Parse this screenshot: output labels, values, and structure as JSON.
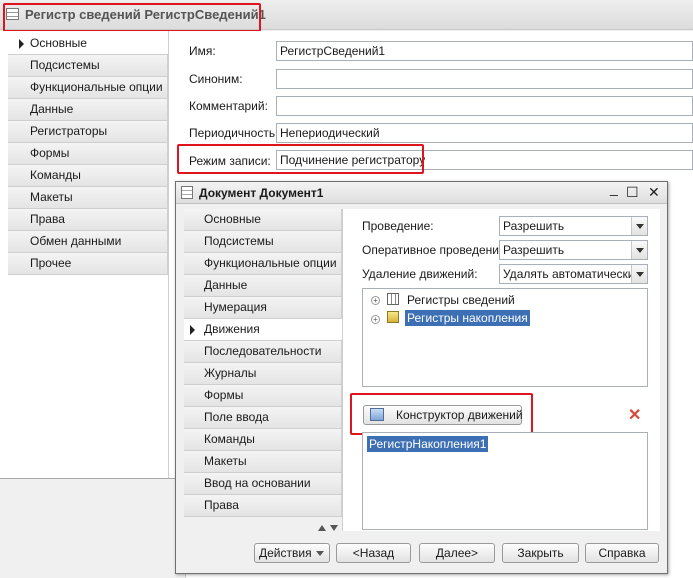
{
  "main_window": {
    "title": "Регистр сведений РегистрСведений1",
    "nav": [
      "Основные",
      "Подсистемы",
      "Функциональные опции",
      "Данные",
      "Регистраторы",
      "Формы",
      "Команды",
      "Макеты",
      "Права",
      "Обмен данными",
      "Прочее"
    ],
    "fields": {
      "name_label": "Имя:",
      "name_value": "РегистрСведений1",
      "synonym_label": "Синоним:",
      "synonym_value": "",
      "comment_label": "Комментарий:",
      "comment_value": "",
      "period_label": "Периодичность:",
      "period_value": "Непериодический",
      "mode_label": "Режим записи:",
      "mode_value": "Подчинение регистратору"
    }
  },
  "dialog": {
    "title": "Документ Документ1",
    "window_buttons": {
      "minimize": "_",
      "maximize": "☐",
      "close": "✕"
    },
    "nav": [
      "Основные",
      "Подсистемы",
      "Функциональные опции",
      "Данные",
      "Нумерация",
      "Движения",
      "Последовательности",
      "Журналы",
      "Формы",
      "Поле ввода",
      "Команды",
      "Макеты",
      "Ввод на основании",
      "Права"
    ],
    "posting_label": "Проведение:",
    "posting_value": "Разрешить",
    "online_label": "Оперативное проведение:",
    "online_value": "Разрешить",
    "delete_label": "Удаление движений:",
    "delete_value": "Удалять автоматически п",
    "tree": [
      {
        "label": "Регистры сведений",
        "icon": "info-register-icon"
      },
      {
        "label": "Регистры накопления",
        "icon": "accumulation-register-icon"
      }
    ],
    "constructor_button": "Конструктор движений",
    "registers_list": [
      "РегистрНакопления1"
    ],
    "footer": {
      "actions": "Действия",
      "back": "<Назад",
      "next": "Далее>",
      "close": "Закрыть",
      "help": "Справка"
    }
  },
  "colors": {
    "highlight": "#e0141e",
    "selection": "#3d6fb4",
    "delete_x": "#d9463c"
  }
}
